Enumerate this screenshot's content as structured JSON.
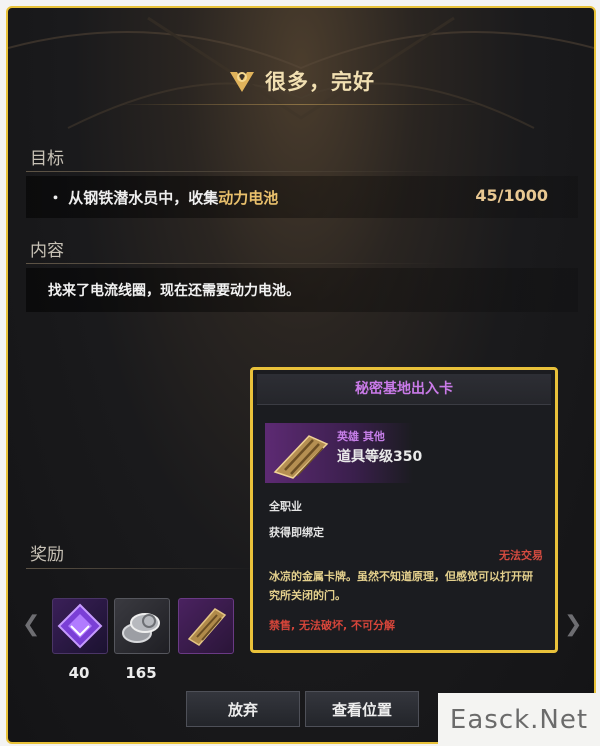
{
  "quest": {
    "title": "很多，完好",
    "objective_label": "目标",
    "objective_prefix": "・ 从钢铁潜水员中，收集",
    "objective_highlight": "动力电池",
    "objective_progress": "45/1000",
    "content_label": "内容",
    "content_text": "找来了电流线圈，现在还需要动力电池。",
    "reward_label": "奖励"
  },
  "rewards": [
    {
      "icon": "purple-crystal-icon",
      "count": "40"
    },
    {
      "icon": "silver-coins-icon",
      "count": "165"
    },
    {
      "icon": "access-card-icon",
      "count": ""
    }
  ],
  "buttons": {
    "abandon": "放弃",
    "view_location": "查看位置"
  },
  "tooltip": {
    "name": "秘密基地出入卡",
    "grade": "英雄 其他",
    "item_level": "道具等级350",
    "class": "全职业",
    "binding": "获得即绑定",
    "trade": "无法交易",
    "description": "冰凉的金属卡牌。虽然不知道原理，但感觉可以打开研究所关闭的门。",
    "restrictions": "禁售, 无法破坏, 不可分解"
  },
  "watermark": "Easck.Net",
  "colors": {
    "accent_gold": "#e9c13a",
    "highlight": "#e9c06c",
    "epic_purple": "#c57ee7",
    "warning_red": "#d44b40"
  }
}
